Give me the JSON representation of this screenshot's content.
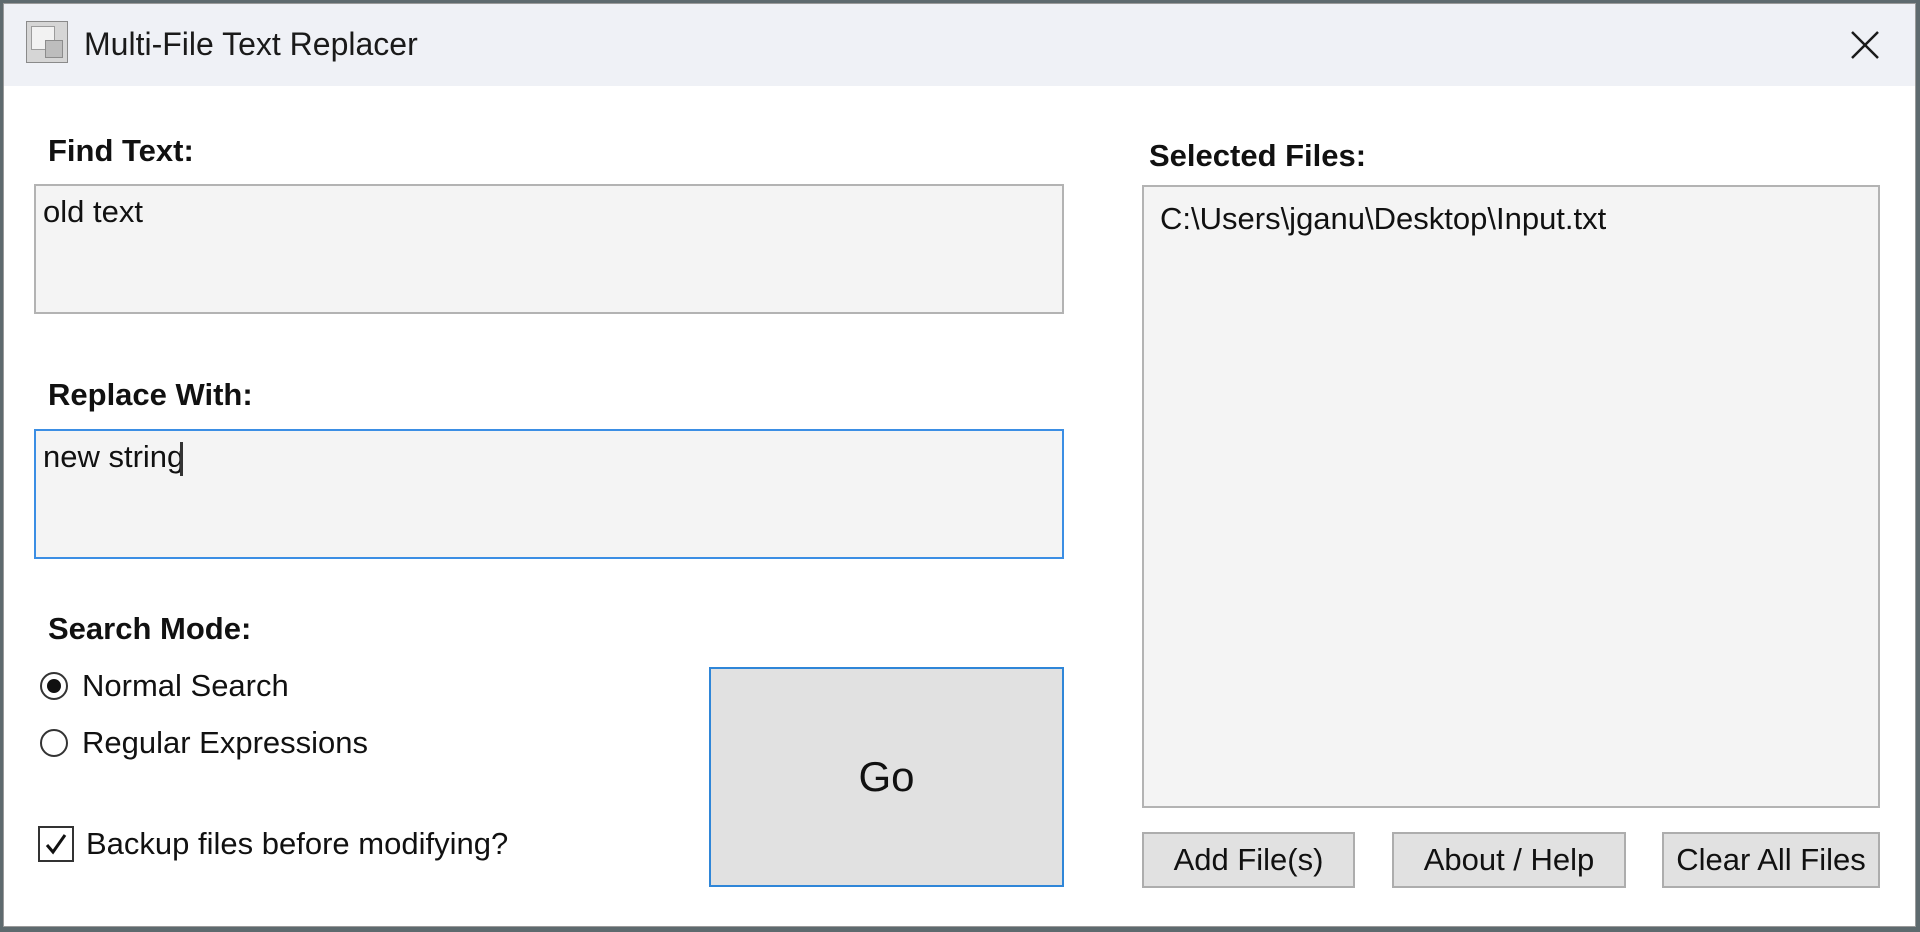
{
  "window": {
    "title": "Multi-File Text Replacer",
    "close_symbol": "×"
  },
  "find": {
    "label": "Find Text:",
    "value": "old text"
  },
  "replace": {
    "label": "Replace With:",
    "value": "new string"
  },
  "search_mode": {
    "label": "Search Mode:",
    "options": [
      {
        "label": "Normal Search",
        "selected": true
      },
      {
        "label": "Regular Expressions",
        "selected": false
      }
    ]
  },
  "backup": {
    "label": "Backup files before modifying?",
    "checked": true
  },
  "go_button": {
    "label": "Go"
  },
  "files": {
    "label": "Selected Files:",
    "items": [
      "C:\\Users\\jganu\\Desktop\\Input.txt"
    ]
  },
  "buttons": {
    "add_files": "Add File(s)",
    "about_help": "About / Help",
    "clear_all": "Clear All Files"
  },
  "colors": {
    "focus_border": "#3b8ee4",
    "titlebar_bg": "#eff1f6",
    "button_bg": "#e1e1e1",
    "field_bg": "#f4f4f4"
  },
  "icons": {
    "app": "app-window-icon",
    "close": "close-icon",
    "check": "checkmark-icon"
  }
}
